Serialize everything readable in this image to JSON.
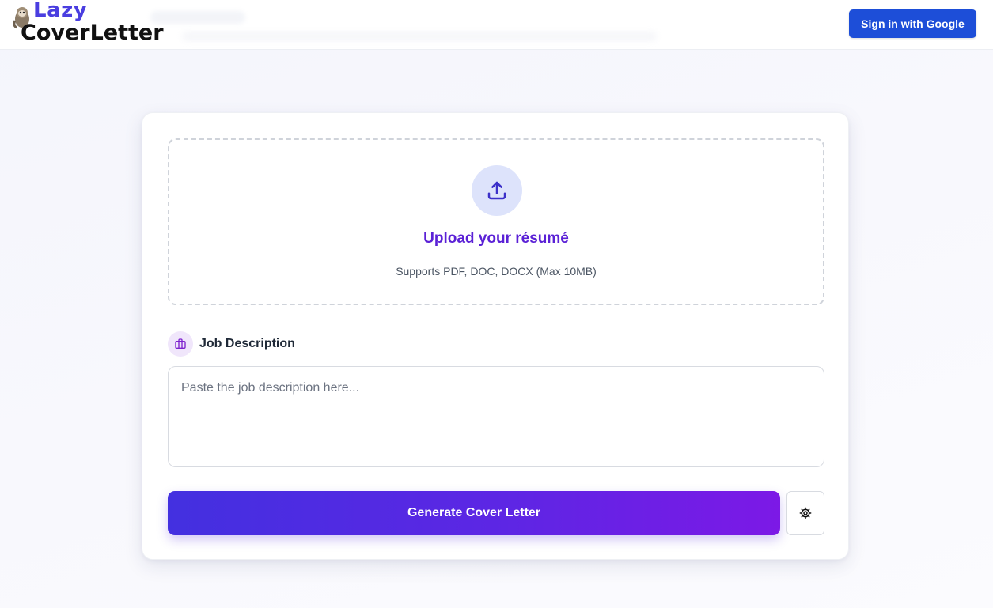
{
  "header": {
    "logo_line1": "Lazy",
    "logo_line2": "CoverLetter",
    "signin_label": "Sign in with Google"
  },
  "upload": {
    "title": "Upload your résumé",
    "subtitle": "Supports PDF, DOC, DOCX (Max 10MB)",
    "icon": "upload-icon"
  },
  "job_description": {
    "label": "Job Description",
    "icon": "briefcase-icon",
    "placeholder": "Paste the job description here...",
    "value": ""
  },
  "actions": {
    "generate_label": "Generate Cover Letter",
    "settings_icon": "gear-icon"
  },
  "colors": {
    "primary_blue": "#1d4ed8",
    "accent_purple": "#5b21d6",
    "gradient_start": "#4330e0",
    "gradient_end": "#7c19e6"
  }
}
